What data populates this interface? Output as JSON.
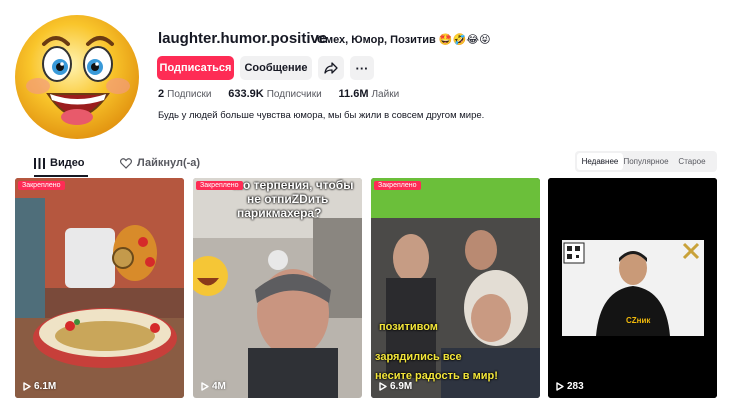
{
  "profile": {
    "username": "laughter.humor.positive",
    "display_name": "Смех, Юмор, Позитив 🤩🤣😂😝",
    "follow_label": "Подписаться",
    "message_label": "Сообщение",
    "following_count": "2",
    "following_label": "Подписки",
    "followers_count": "633.9K",
    "followers_label": "Подписчики",
    "likes_count": "11.6M",
    "likes_label": "Лайки",
    "bio": "Будь у людей больше чувства юмора, мы бы жили в совсем другом мире."
  },
  "tabs": [
    {
      "label": "Видео",
      "icon": "grid-icon"
    },
    {
      "label": "Лайкнул(-а)",
      "icon": "heart-outline-icon"
    }
  ],
  "sort_options": [
    "Недавнее",
    "Популярное",
    "Старое"
  ],
  "videos": [
    {
      "pinned_label": "Закреплено",
      "views": "6.1M"
    },
    {
      "pinned_label": "Закреплено",
      "views": "4M",
      "caption_lines": [
        "...о терпения, чтобы",
        "не отпиZDить",
        "парикмахера?"
      ]
    },
    {
      "pinned_label": "Закреплено",
      "views": "6.9M",
      "caption_lines": [
        "позитивом",
        "зарядились все",
        "несите радость в мир!"
      ]
    },
    {
      "views": "283",
      "logo_text": "CZник"
    }
  ],
  "colors": {
    "accent": "#fe2c55",
    "text": "#161823",
    "muted": "#57585f",
    "button_bg": "#f1f1f2"
  }
}
